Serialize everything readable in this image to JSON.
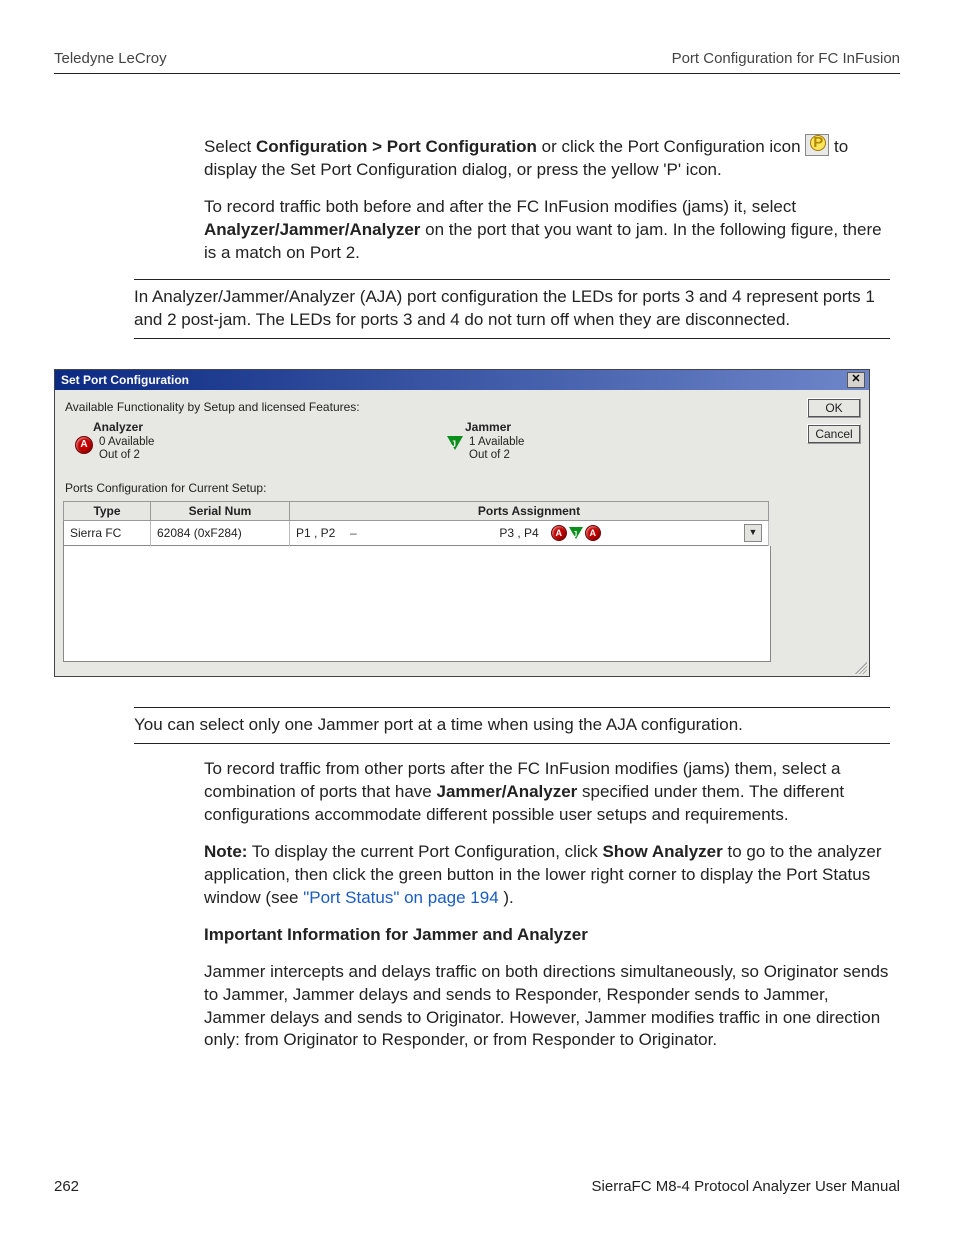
{
  "header": {
    "left": "Teledyne LeCroy",
    "right": "Port Configuration for FC InFusion"
  },
  "para1": {
    "pre": "Select ",
    "bold1": "Configuration > Port Configuration",
    "mid": " or click the Port Configuration icon ",
    "post": " to display the Set Port Configuration dialog, or press the yellow 'P' icon."
  },
  "para2": {
    "pre": "To record traffic both before and after the FC InFusion modifies (jams) it, select ",
    "bold1": "Analyzer/Jammer/Analyzer",
    "post": " on the port that you want to jam. In the following figure, there is a match on Port 2."
  },
  "note1": "In Analyzer/Jammer/Analyzer (AJA) port configuration the LEDs for ports 3 and 4 represent ports 1 and 2 post-jam. The LEDs for ports 3 and 4 do not turn off when they are disconnected.",
  "dialog": {
    "title": "Set Port Configuration",
    "avail_label": "Available Functionality by Setup and licensed Features:",
    "analyzer": {
      "head": "Analyzer",
      "line1": "0 Available",
      "line2": "Out of 2"
    },
    "jammer": {
      "head": "Jammer",
      "line1": "1 Available",
      "line2": "Out of 2"
    },
    "ports_label": "Ports Configuration for Current Setup:",
    "cols": {
      "type": "Type",
      "serial": "Serial Num",
      "assign": "Ports Assignment"
    },
    "row": {
      "type": "Sierra FC",
      "serial": "62084 (0xF284)",
      "left_ports": "P1 , P2",
      "dash": "–",
      "right_ports": "P3 , P4"
    },
    "buttons": {
      "ok": "OK",
      "cancel": "Cancel"
    }
  },
  "note2": "You can select only one Jammer port at a time when using the AJA configuration.",
  "para3": {
    "pre": "To record traffic from other ports after the FC InFusion modifies (jams) them, select a combination of ports that have ",
    "bold1": "Jammer/Analyzer",
    "post": " specified under them. The different configurations accommodate different possible user setups and requirements."
  },
  "para4": {
    "lead": "Note:",
    "pre": " To display the current Port Configuration, click ",
    "bold1": "Show Analyzer",
    "mid": " to go to the analyzer application, then click the green button in the lower right corner to display the Port Status window (see ",
    "link": "\"Port Status\" on page 194",
    "post": ")."
  },
  "heading4": "Important Information for Jammer and Analyzer",
  "para5": "Jammer intercepts and delays traffic on both directions simultaneously, so Originator sends to Jammer, Jammer delays and sends to Responder, Responder sends to Jammer, Jammer delays and sends to Originator. However, Jammer modifies traffic in one direction only: from Originator to Responder, or from Responder to Originator.",
  "footer": {
    "page": "262",
    "manual": "SierraFC M8-4 Protocol Analyzer User Manual"
  }
}
